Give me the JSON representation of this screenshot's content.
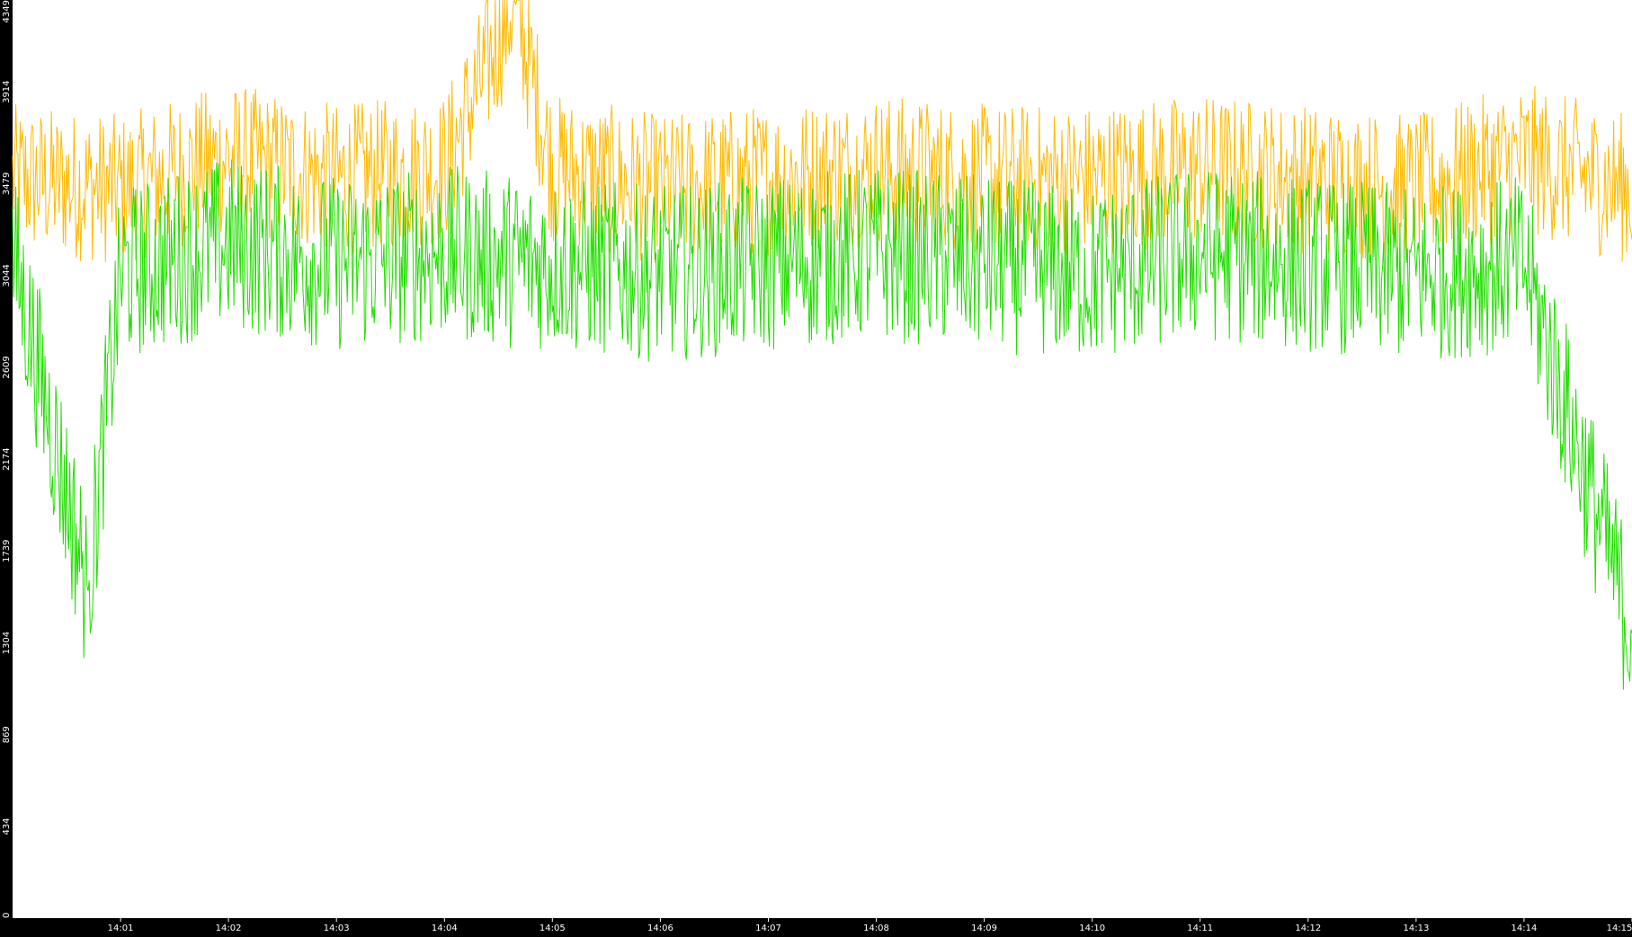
{
  "chart_data": {
    "type": "line",
    "title": "",
    "xlabel": "",
    "ylabel": "",
    "grid": false,
    "legend": "none",
    "background": "#ffffff",
    "frame_color": "#000000",
    "tick_label_color": "#ffffff",
    "x_tick_labels": [
      "14:01",
      "14:02",
      "14:03",
      "14:04",
      "14:05",
      "14:06",
      "14:07",
      "14:08",
      "14:09",
      "14:10",
      "14:11",
      "14:12",
      "14:13",
      "14:14",
      "14:15"
    ],
    "x_tick_minutes": [
      1,
      2,
      3,
      4,
      5,
      6,
      7,
      8,
      9,
      10,
      11,
      12,
      13,
      14,
      15
    ],
    "xlim_minutes": [
      0,
      15
    ],
    "y_ticks": [
      0,
      434,
      869,
      1304,
      1739,
      2174,
      2609,
      3044,
      3479,
      3914,
      4349
    ],
    "ylim": [
      0,
      4349
    ],
    "series": [
      {
        "color": "#ffbb00",
        "minutes": [
          0,
          1,
          2,
          3,
          4,
          4.65,
          5,
          6,
          7,
          8,
          9,
          10,
          11,
          12,
          13,
          14,
          15
        ],
        "values": [
          3500,
          3450,
          3600,
          3500,
          3550,
          4349,
          3550,
          3450,
          3500,
          3550,
          3500,
          3500,
          3550,
          3500,
          3450,
          3600,
          3450
        ]
      },
      {
        "color": "#22dd00",
        "minutes": [
          0,
          0.7,
          1,
          2,
          3,
          4,
          5,
          6,
          7,
          8,
          9,
          10,
          11,
          12,
          13,
          14,
          15
        ],
        "values": [
          3150,
          1550,
          3050,
          3200,
          3100,
          3150,
          3100,
          3050,
          3100,
          3150,
          3100,
          3050,
          3150,
          3100,
          3050,
          3100,
          1350
        ]
      }
    ]
  }
}
